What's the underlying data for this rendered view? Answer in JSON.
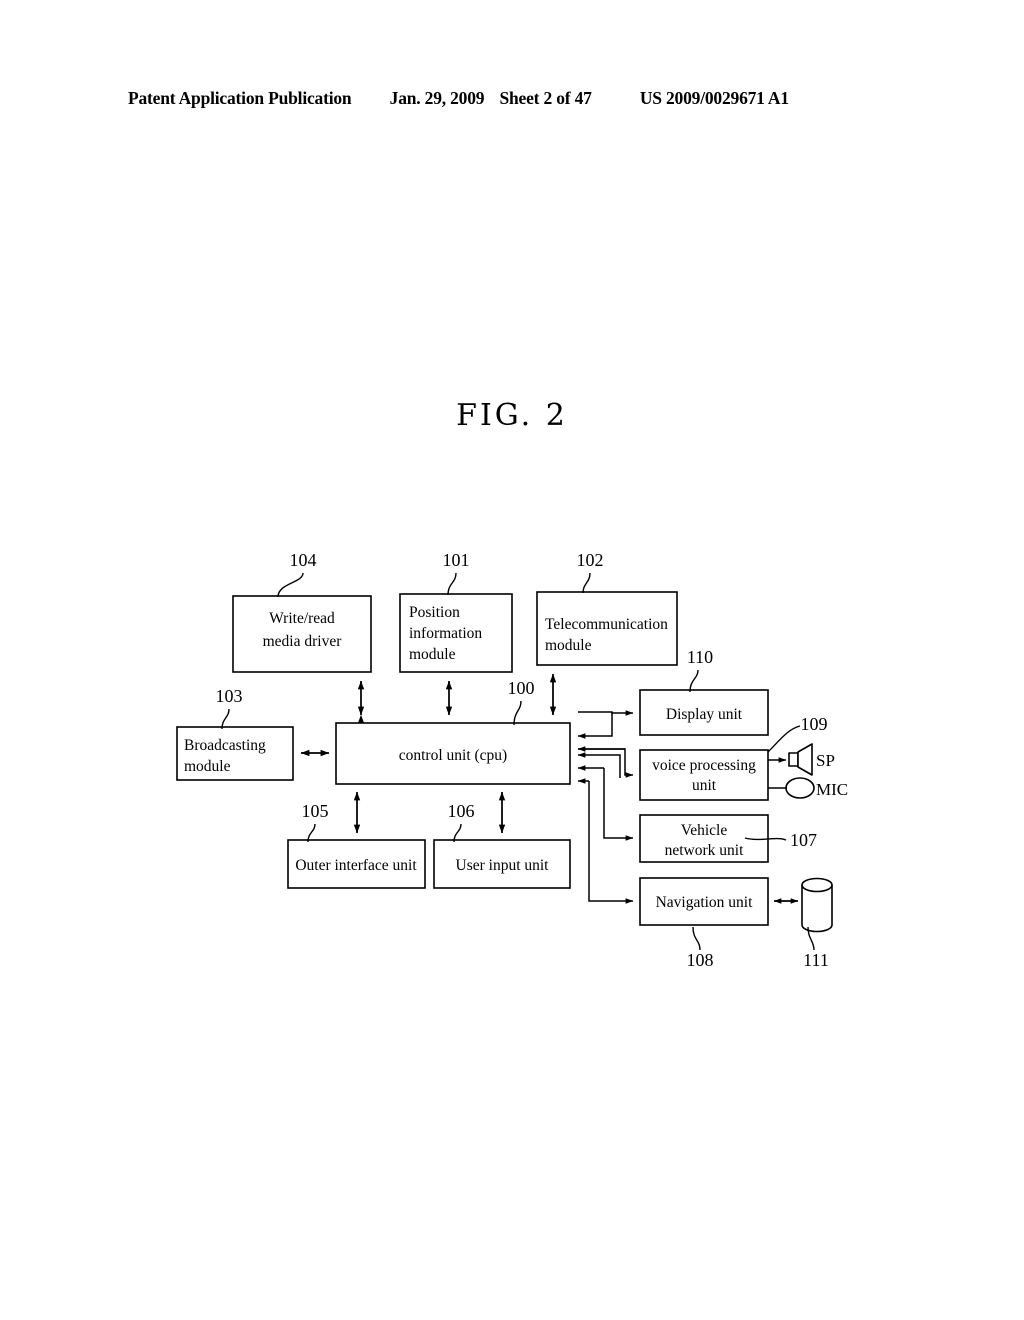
{
  "header": {
    "publication": "Patent Application Publication",
    "date": "Jan. 29, 2009",
    "sheet": "Sheet 2 of 47",
    "document_number": "US 2009/0029671 A1"
  },
  "figure": {
    "title": "FIG. 2"
  },
  "diagram": {
    "type": "block-diagram",
    "blocks": [
      {
        "id": "write_read",
        "ref": "104",
        "label": "Write/read\nmedia driver",
        "line1": "Write/read",
        "line2": "media driver",
        "align": "center"
      },
      {
        "id": "position",
        "ref": "101",
        "label": "Position information module",
        "line1": "Position",
        "line2": "information",
        "line3": "module",
        "align": "left"
      },
      {
        "id": "telecom",
        "ref": "102",
        "label": "Telecommunication module",
        "line1": "Telecommunication",
        "line2": "module",
        "align": "left"
      },
      {
        "id": "broadcasting",
        "ref": "103",
        "label": "Broadcasting module",
        "line1": "Broadcasting",
        "line2": "module",
        "align": "left"
      },
      {
        "id": "control_unit",
        "ref": "100",
        "label": "control unit (cpu)",
        "line1": "control unit (cpu)",
        "align": "center"
      },
      {
        "id": "outer_interface",
        "ref": "105",
        "label": "Outer interface unit",
        "line1": "Outer interface unit",
        "align": "center"
      },
      {
        "id": "user_input",
        "ref": "106",
        "label": "User input unit",
        "line1": "User input unit",
        "align": "center"
      },
      {
        "id": "display_unit",
        "ref": "110",
        "label": "Display unit",
        "line1": "Display unit",
        "align": "center"
      },
      {
        "id": "voice_processing",
        "ref": "109",
        "label": "voice processing unit",
        "line1": "voice processing",
        "line2": "unit",
        "align": "center"
      },
      {
        "id": "vehicle_network",
        "ref": "107",
        "label": "Vehicle network unit",
        "line1": "Vehicle",
        "line2": "network unit",
        "align": "center"
      },
      {
        "id": "navigation_unit",
        "ref": "108",
        "label": "Navigation unit",
        "line1": "Navigation unit",
        "align": "center"
      },
      {
        "id": "storage",
        "ref": "111",
        "label": "",
        "shape": "cylinder"
      }
    ],
    "peripherals": [
      {
        "id": "speaker",
        "label": "SP",
        "icon": "speaker-icon"
      },
      {
        "id": "microphone",
        "label": "MIC",
        "icon": "microphone-icon"
      }
    ],
    "connections": [
      {
        "from": "write_read",
        "to": "control_unit",
        "arrow": "both"
      },
      {
        "from": "position",
        "to": "control_unit",
        "arrow": "both"
      },
      {
        "from": "telecom",
        "to": "control_unit",
        "arrow": "both"
      },
      {
        "from": "broadcasting",
        "to": "control_unit",
        "arrow": "both"
      },
      {
        "from": "control_unit",
        "to": "outer_interface",
        "arrow": "both"
      },
      {
        "from": "control_unit",
        "to": "user_input",
        "arrow": "both"
      },
      {
        "from": "control_unit",
        "to": "display_unit",
        "arrow": "both"
      },
      {
        "from": "control_unit",
        "to": "voice_processing",
        "arrow": "both"
      },
      {
        "from": "control_unit",
        "to": "vehicle_network",
        "arrow": "both"
      },
      {
        "from": "control_unit",
        "to": "navigation_unit",
        "arrow": "both"
      },
      {
        "from": "voice_processing",
        "to": "speaker",
        "arrow": "forward"
      },
      {
        "from": "voice_processing",
        "to": "microphone",
        "arrow": "none"
      },
      {
        "from": "navigation_unit",
        "to": "storage",
        "arrow": "both"
      }
    ]
  }
}
